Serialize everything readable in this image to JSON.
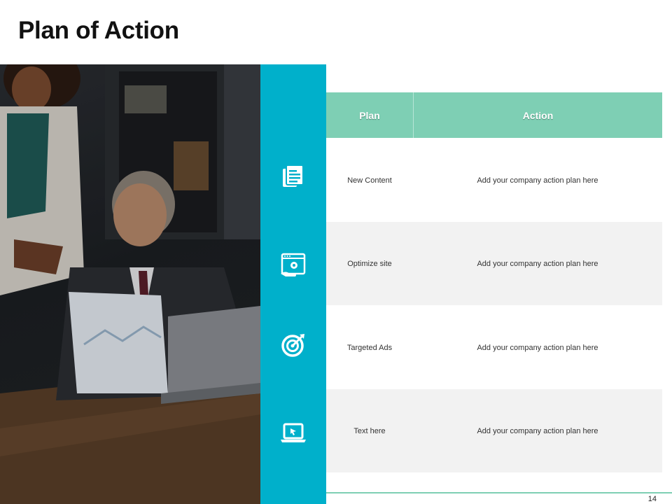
{
  "slide": {
    "title": "Plan of Action",
    "page_number": "14"
  },
  "table": {
    "headers": {
      "plan": "Plan",
      "action": "Action"
    },
    "rows": [
      {
        "plan": "New Content",
        "action": "Add your company action plan here",
        "icon": "document-icon"
      },
      {
        "plan": "Optimize site",
        "action": "Add your company action plan here",
        "icon": "optimize-site-icon"
      },
      {
        "plan": "Targeted Ads",
        "action": "Add your company action plan here",
        "icon": "target-icon"
      },
      {
        "plan": "Text here",
        "action": "Add your company action plan here",
        "icon": "laptop-icon"
      }
    ]
  },
  "colors": {
    "teal_bar": "#00b0cb",
    "header_green": "#7ecfb4",
    "row_shade": "#f2f2f2"
  }
}
